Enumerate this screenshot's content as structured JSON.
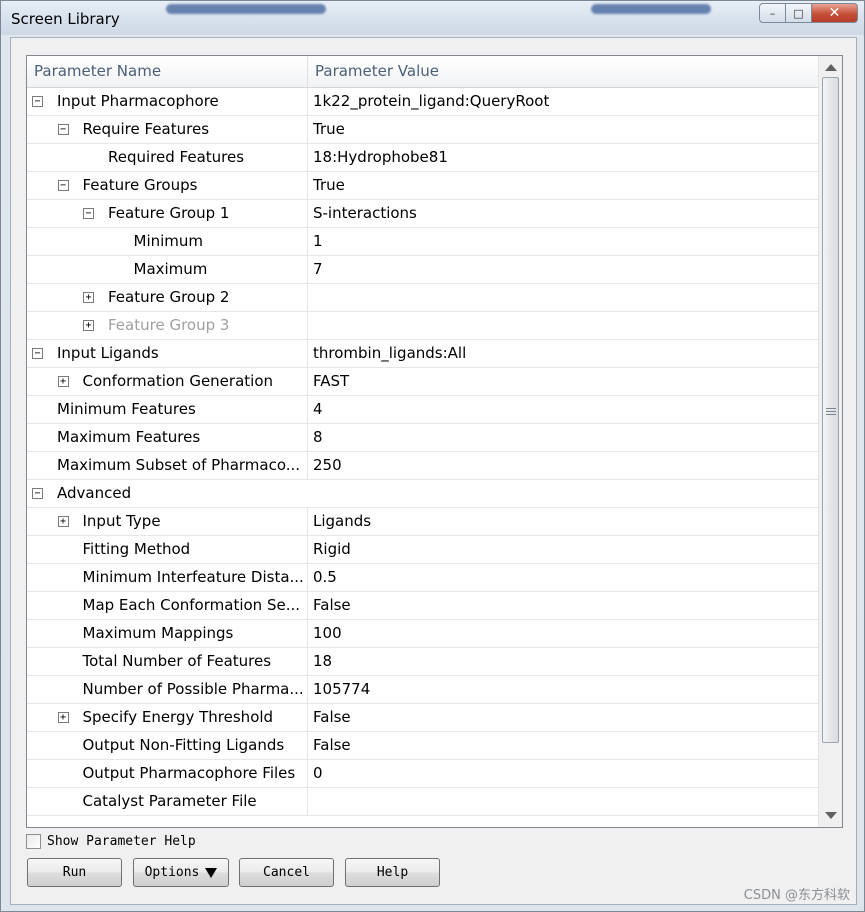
{
  "window": {
    "title": "Screen Library",
    "minimize_glyph": "–",
    "maximize_glyph": "□",
    "close_glyph": "✕"
  },
  "grid": {
    "col_name": "Parameter Name",
    "col_value": "Parameter Value",
    "rows": [
      {
        "name": "Input Pharmacophore",
        "value": "1k22_protein_ligand:QueryRoot",
        "level": 0,
        "toggle": "−"
      },
      {
        "name": "Require Features",
        "value": "True",
        "level": 1,
        "toggle": "−"
      },
      {
        "name": "Required Features",
        "value": "18:Hydrophobe81",
        "level": 2,
        "toggle": ""
      },
      {
        "name": "Feature Groups",
        "value": "True",
        "level": 1,
        "toggle": "−"
      },
      {
        "name": "Feature Group 1",
        "value": "S-interactions",
        "level": 2,
        "toggle": "−"
      },
      {
        "name": "Minimum",
        "value": "1",
        "level": 3,
        "toggle": ""
      },
      {
        "name": "Maximum",
        "value": "7",
        "level": 3,
        "toggle": ""
      },
      {
        "name": "Feature Group 2",
        "value": "",
        "level": 2,
        "toggle": "+"
      },
      {
        "name": "Feature Group 3",
        "value": "",
        "level": 2,
        "toggle": "+",
        "disabled": true
      },
      {
        "name": "Input Ligands",
        "value": "thrombin_ligands:All",
        "level": 0,
        "toggle": "−"
      },
      {
        "name": "Conformation Generation",
        "value": "FAST",
        "level": 1,
        "toggle": "+"
      },
      {
        "name": "Minimum Features",
        "value": "4",
        "level": 0,
        "toggle": "",
        "notoggle_indent": true
      },
      {
        "name": "Maximum Features",
        "value": "8",
        "level": 0,
        "toggle": "",
        "notoggle_indent": true
      },
      {
        "name": "Maximum Subset of Pharmaco...",
        "value": "250",
        "level": 0,
        "toggle": "",
        "notoggle_indent": true
      },
      {
        "name": "Advanced",
        "value": "",
        "level": 0,
        "toggle": "−",
        "full": true
      },
      {
        "name": "Input Type",
        "value": "Ligands",
        "level": 1,
        "toggle": "+"
      },
      {
        "name": "Fitting Method",
        "value": "Rigid",
        "level": 1,
        "toggle": ""
      },
      {
        "name": "Minimum Interfeature Dista...",
        "value": "0.5",
        "level": 1,
        "toggle": ""
      },
      {
        "name": "Map Each Conformation Se...",
        "value": "False",
        "level": 1,
        "toggle": ""
      },
      {
        "name": "Maximum Mappings",
        "value": "100",
        "level": 1,
        "toggle": ""
      },
      {
        "name": "Total Number of Features",
        "value": "18",
        "level": 1,
        "toggle": ""
      },
      {
        "name": "Number of Possible Pharma...",
        "value": "105774",
        "level": 1,
        "toggle": ""
      },
      {
        "name": "Specify Energy Threshold",
        "value": "False",
        "level": 1,
        "toggle": "+"
      },
      {
        "name": "Output Non-Fitting Ligands",
        "value": "False",
        "level": 1,
        "toggle": ""
      },
      {
        "name": "Output Pharmacophore Files",
        "value": "0",
        "level": 1,
        "toggle": ""
      },
      {
        "name": "Catalyst Parameter File",
        "value": "",
        "level": 1,
        "toggle": ""
      }
    ]
  },
  "show_help_label": "Show Parameter Help",
  "buttons": {
    "run": "Run",
    "options": "Options",
    "cancel": "Cancel",
    "help": "Help"
  },
  "watermark": "CSDN @东方科软"
}
